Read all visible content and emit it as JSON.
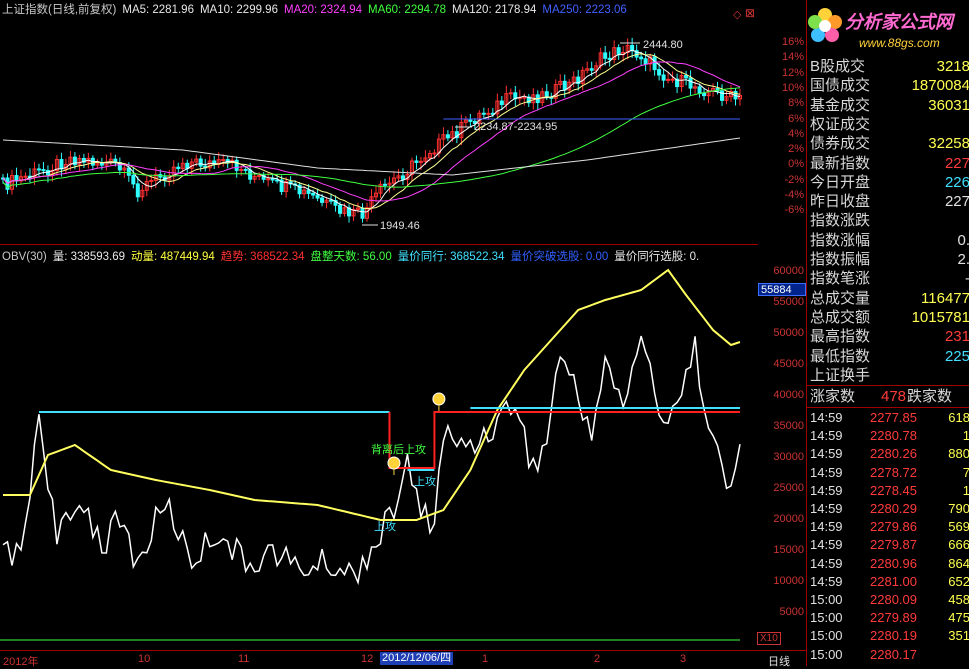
{
  "main_legend": [
    {
      "text": "上证指数(日线,前复权)",
      "color": "#c8c8c8"
    },
    {
      "text": "MA5: 2281.96",
      "color": "#e8e8e8"
    },
    {
      "text": "MA10: 2299.96",
      "color": "#e8e8e8"
    },
    {
      "text": "MA20: 2324.94",
      "color": "#ff40ff"
    },
    {
      "text": "MA60: 2294.78",
      "color": "#40ff40"
    },
    {
      "text": "MA120: 2178.94",
      "color": "#e8e8e8"
    },
    {
      "text": "MA250: 2223.06",
      "color": "#4060ff"
    }
  ],
  "price_annotations": {
    "high": "2444.80",
    "mid": "2234.87-2234.95",
    "low": "1949.46"
  },
  "price_ticks": [
    "16%",
    "14%",
    "12%",
    "10%",
    "8%",
    "6%",
    "4%",
    "2%",
    "0%",
    "-2%",
    "-4%",
    "-6%"
  ],
  "obv_legend": [
    {
      "text": "OBV(30)",
      "color": "#c8c8c8"
    },
    {
      "text": "量: 338593.69",
      "color": "#e8e8e8"
    },
    {
      "text": "动量: 487449.94",
      "color": "#ffff40"
    },
    {
      "text": "趋势: 368522.34",
      "color": "#ff3030"
    },
    {
      "text": "盘整天数: 56.00",
      "color": "#40ff40"
    },
    {
      "text": "量价同行: 368522.34",
      "color": "#40e0ff"
    },
    {
      "text": "量价突破选股: 0.00",
      "color": "#3060ff"
    },
    {
      "text": "量价同行选股: 0.",
      "color": "#e8e8e8"
    }
  ],
  "obv_ticks": [
    "60000",
    "55000",
    "50000",
    "45000",
    "40000",
    "35000",
    "30000",
    "25000",
    "20000",
    "15000",
    "10000",
    "5000"
  ],
  "obv_badge": "55884",
  "obv_annotations": {
    "divergence": "背离后上攻",
    "attack": "上攻",
    "attack2": "上攻"
  },
  "x_factor": "X10",
  "date_ticks": [
    "2012年",
    "10",
    "11",
    "12",
    "1",
    "2",
    "3"
  ],
  "date_cursor": "2012/12/06/四",
  "period_label": "日线",
  "logo": {
    "title": "分析家公式网",
    "url": "www.88gs.com"
  },
  "stats": [
    {
      "label": "B股成交",
      "value": "3218"
    },
    {
      "label": "国债成交",
      "value": "1870084"
    },
    {
      "label": "基金成交",
      "value": "36031"
    },
    {
      "label": "权证成交",
      "value": ""
    },
    {
      "label": "债券成交",
      "value": "32258"
    },
    {
      "label": "最新指数",
      "value": "227"
    },
    {
      "label": "今日开盘",
      "value": "226"
    },
    {
      "label": "昨日收盘",
      "value": "227"
    },
    {
      "label": "指数涨跌",
      "value": ""
    },
    {
      "label": "指数涨幅",
      "value": "0."
    },
    {
      "label": "指数振幅",
      "value": "2."
    },
    {
      "label": "指数笔涨",
      "value": "-"
    },
    {
      "label": "总成交量",
      "value": "116477"
    },
    {
      "label": "总成交额",
      "value": "1015781"
    },
    {
      "label": "最高指数",
      "value": "231"
    },
    {
      "label": "最低指数",
      "value": "225"
    },
    {
      "label": "上证换手",
      "value": ""
    }
  ],
  "adv_dec": {
    "up_label": "涨家数",
    "up_value": "478",
    "down_label": "跌家数"
  },
  "ticks": [
    {
      "time": "14:59",
      "price": "2277.85",
      "vol": "618"
    },
    {
      "time": "14:59",
      "price": "2280.78",
      "vol": "1"
    },
    {
      "time": "14:59",
      "price": "2280.26",
      "vol": "880"
    },
    {
      "time": "14:59",
      "price": "2278.72",
      "vol": "7"
    },
    {
      "time": "14:59",
      "price": "2278.45",
      "vol": "1"
    },
    {
      "time": "14:59",
      "price": "2280.29",
      "vol": "790"
    },
    {
      "time": "14:59",
      "price": "2279.86",
      "vol": "569"
    },
    {
      "time": "14:59",
      "price": "2279.87",
      "vol": "666"
    },
    {
      "time": "14:59",
      "price": "2280.96",
      "vol": "864"
    },
    {
      "time": "14:59",
      "price": "2281.00",
      "vol": "652"
    },
    {
      "time": "15:00",
      "price": "2280.09",
      "vol": "458"
    },
    {
      "time": "15:00",
      "price": "2279.89",
      "vol": "475"
    },
    {
      "time": "15:00",
      "price": "2280.19",
      "vol": "351"
    },
    {
      "time": "15:00",
      "price": "2280.17",
      "vol": ""
    }
  ],
  "colors": {
    "up": "#ff3030",
    "down": "#30ffff",
    "ma5": "#ffffff",
    "ma20": "#ff40ff",
    "ma60": "#40ff40",
    "ma120": "#e0e0e0",
    "ma250": "#4060ff",
    "volume": "#ffffff",
    "momentum": "#ffff60",
    "trend": "#ff2020",
    "band": "#40e0ff"
  }
}
